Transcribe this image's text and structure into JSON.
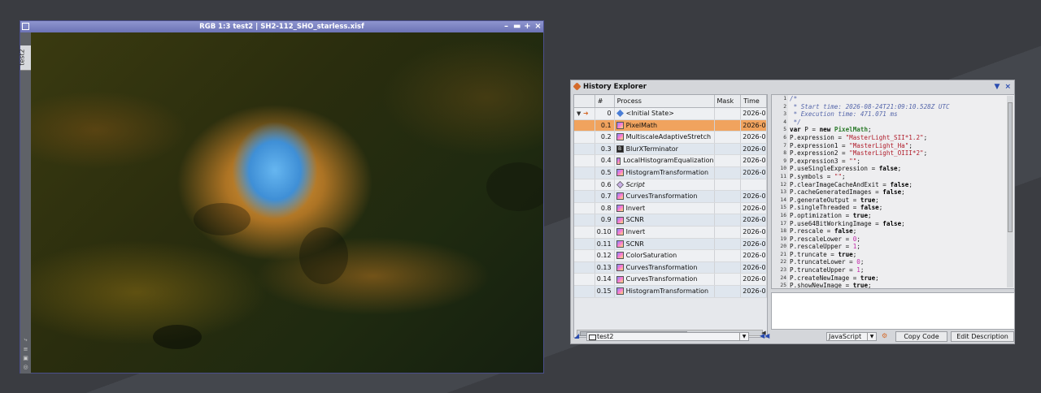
{
  "image_window": {
    "title": "RGB 1:3 test2 | SH2-112_SHO_starless.xisf",
    "tab_label": "test2",
    "controls": [
      "minimize",
      "shade",
      "maximize",
      "close"
    ]
  },
  "history": {
    "title": "History Explorer",
    "columns": [
      "",
      "#",
      "Process",
      "Mask",
      "Time"
    ],
    "rows": [
      {
        "num": "0",
        "process": "<Initial State>",
        "time": "2026-0",
        "icon": "diamond"
      },
      {
        "num": "0.1",
        "process": "PixelMath",
        "time": "2026-0",
        "icon": "process"
      },
      {
        "num": "0.2",
        "process": "MultiscaleAdaptiveStretch",
        "time": "2026-0",
        "icon": "process"
      },
      {
        "num": "0.3",
        "process": "BlurXTerminator",
        "time": "2026-0",
        "icon": "dark"
      },
      {
        "num": "0.4",
        "process": "LocalHistogramEqualization",
        "time": "2026-0",
        "icon": "process"
      },
      {
        "num": "0.5",
        "process": "HistogramTransformation",
        "time": "2026-0",
        "icon": "process"
      },
      {
        "num": "0.6",
        "process": "Script",
        "time": "",
        "icon": "script"
      },
      {
        "num": "0.7",
        "process": "CurvesTransformation",
        "time": "2026-0",
        "icon": "process"
      },
      {
        "num": "0.8",
        "process": "Invert",
        "time": "2026-0",
        "icon": "process"
      },
      {
        "num": "0.9",
        "process": "SCNR",
        "time": "2026-0",
        "icon": "process"
      },
      {
        "num": "0.10",
        "process": "Invert",
        "time": "2026-0",
        "icon": "process"
      },
      {
        "num": "0.11",
        "process": "SCNR",
        "time": "2026-0",
        "icon": "process"
      },
      {
        "num": "0.12",
        "process": "ColorSaturation",
        "time": "2026-0",
        "icon": "process"
      },
      {
        "num": "0.13",
        "process": "CurvesTransformation",
        "time": "2026-0",
        "icon": "process"
      },
      {
        "num": "0.14",
        "process": "CurvesTransformation",
        "time": "2026-0",
        "icon": "process"
      },
      {
        "num": "0.15",
        "process": "HistogramTransformation",
        "time": "2026-0",
        "icon": "process"
      }
    ],
    "selected_row": "0.1",
    "code_lines": [
      {
        "n": "1",
        "parts": [
          [
            "cmt",
            "/*"
          ]
        ]
      },
      {
        "n": "2",
        "parts": [
          [
            "cmt",
            " * Start time: 2026-08-24T21:09:10.528Z UTC"
          ]
        ]
      },
      {
        "n": "3",
        "parts": [
          [
            "cmt",
            " * Execution time: 471.071 ms"
          ]
        ]
      },
      {
        "n": "4",
        "parts": [
          [
            "cmt",
            " */"
          ]
        ]
      },
      {
        "n": "5",
        "parts": [
          [
            "kw",
            "var"
          ],
          [
            "",
            " P = "
          ],
          [
            "kw",
            "new"
          ],
          [
            "",
            " "
          ],
          [
            "cls",
            "PixelMath"
          ],
          [
            "",
            ";"
          ]
        ]
      },
      {
        "n": "6",
        "parts": [
          [
            "",
            "P.expression = "
          ],
          [
            "str",
            "\"MasterLight_SII*1.2\""
          ],
          [
            "",
            ";"
          ]
        ]
      },
      {
        "n": "7",
        "parts": [
          [
            "",
            "P.expression1 = "
          ],
          [
            "str",
            "\"MasterLight_Ha\""
          ],
          [
            "",
            ";"
          ]
        ]
      },
      {
        "n": "8",
        "parts": [
          [
            "",
            "P.expression2 = "
          ],
          [
            "str",
            "\"MasterLight_OIII*2\""
          ],
          [
            "",
            ";"
          ]
        ]
      },
      {
        "n": "9",
        "parts": [
          [
            "",
            "P.expression3 = "
          ],
          [
            "str",
            "\"\""
          ],
          [
            "",
            ";"
          ]
        ]
      },
      {
        "n": "10",
        "parts": [
          [
            "",
            "P.useSingleExpression = "
          ],
          [
            "kw",
            "false"
          ],
          [
            "",
            ";"
          ]
        ]
      },
      {
        "n": "11",
        "parts": [
          [
            "",
            "P.symbols = "
          ],
          [
            "str",
            "\"\""
          ],
          [
            "",
            ";"
          ]
        ]
      },
      {
        "n": "12",
        "parts": [
          [
            "",
            "P.clearImageCacheAndExit = "
          ],
          [
            "kw",
            "false"
          ],
          [
            "",
            ";"
          ]
        ]
      },
      {
        "n": "13",
        "parts": [
          [
            "",
            "P.cacheGeneratedImages = "
          ],
          [
            "kw",
            "false"
          ],
          [
            "",
            ";"
          ]
        ]
      },
      {
        "n": "14",
        "parts": [
          [
            "",
            "P.generateOutput = "
          ],
          [
            "kw",
            "true"
          ],
          [
            "",
            ";"
          ]
        ]
      },
      {
        "n": "15",
        "parts": [
          [
            "",
            "P.singleThreaded = "
          ],
          [
            "kw",
            "false"
          ],
          [
            "",
            ";"
          ]
        ]
      },
      {
        "n": "16",
        "parts": [
          [
            "",
            "P.optimization = "
          ],
          [
            "kw",
            "true"
          ],
          [
            "",
            ";"
          ]
        ]
      },
      {
        "n": "17",
        "parts": [
          [
            "",
            "P.use64BitWorkingImage = "
          ],
          [
            "kw",
            "false"
          ],
          [
            "",
            ";"
          ]
        ]
      },
      {
        "n": "18",
        "parts": [
          [
            "",
            "P.rescale = "
          ],
          [
            "kw",
            "false"
          ],
          [
            "",
            ";"
          ]
        ]
      },
      {
        "n": "19",
        "parts": [
          [
            "",
            "P.rescaleLower = "
          ],
          [
            "num",
            "0"
          ],
          [
            "",
            ";"
          ]
        ]
      },
      {
        "n": "20",
        "parts": [
          [
            "",
            "P.rescaleUpper = "
          ],
          [
            "num",
            "1"
          ],
          [
            "",
            ";"
          ]
        ]
      },
      {
        "n": "21",
        "parts": [
          [
            "",
            "P.truncate = "
          ],
          [
            "kw",
            "true"
          ],
          [
            "",
            ";"
          ]
        ]
      },
      {
        "n": "22",
        "parts": [
          [
            "",
            "P.truncateLower = "
          ],
          [
            "num",
            "0"
          ],
          [
            "",
            ";"
          ]
        ]
      },
      {
        "n": "23",
        "parts": [
          [
            "",
            "P.truncateUpper = "
          ],
          [
            "num",
            "1"
          ],
          [
            "",
            ";"
          ]
        ]
      },
      {
        "n": "24",
        "parts": [
          [
            "",
            "P.createNewImage = "
          ],
          [
            "kw",
            "true"
          ],
          [
            "",
            ";"
          ]
        ]
      },
      {
        "n": "25",
        "parts": [
          [
            "",
            "P.showNewImage = "
          ],
          [
            "kw",
            "true"
          ],
          [
            "",
            ";"
          ]
        ]
      }
    ],
    "image_selector": "test2",
    "language": "JavaScript",
    "copy_code_label": "Copy Code",
    "edit_description_label": "Edit Description"
  }
}
